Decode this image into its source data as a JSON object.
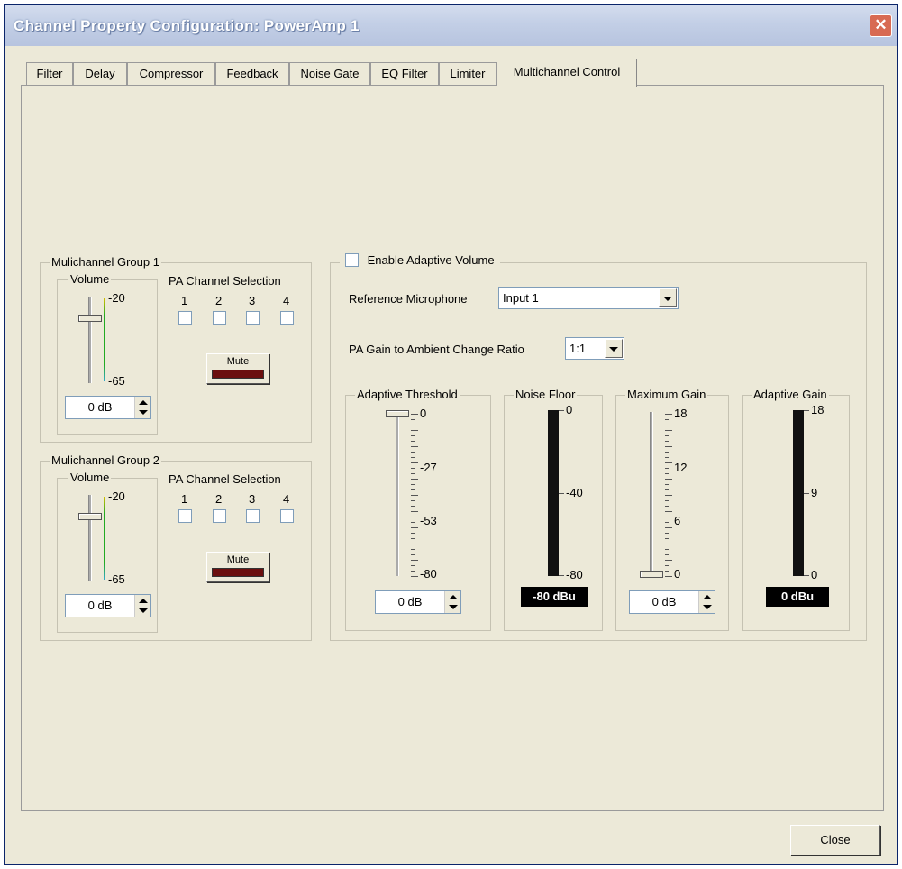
{
  "window": {
    "title": "Channel Property Configuration: PowerAmp 1",
    "close_glyph": "✕"
  },
  "tabs": [
    "Filter",
    "Delay",
    "Compressor",
    "Feedback",
    "Noise Gate",
    "EQ Filter",
    "Limiter",
    "Multichannel Control"
  ],
  "active_tab": "Multichannel Control",
  "group1": {
    "title": "Mulichannel Group 1",
    "volume_label": "Volume",
    "scale_top": "-20",
    "scale_bottom": "-65",
    "value": "0 dB",
    "pa_label": "PA Channel Selection",
    "channels": [
      "1",
      "2",
      "3",
      "4"
    ],
    "mute_label": "Mute"
  },
  "group2": {
    "title": "Mulichannel Group 2",
    "volume_label": "Volume",
    "scale_top": "-20",
    "scale_bottom": "-65",
    "value": "0 dB",
    "pa_label": "PA Channel Selection",
    "channels": [
      "1",
      "2",
      "3",
      "4"
    ],
    "mute_label": "Mute"
  },
  "adaptive": {
    "enable_label": "Enable Adaptive Volume",
    "ref_mic_label": "Reference Microphone",
    "ref_mic_value": "Input 1",
    "ratio_label": "PA Gain to Ambient Change Ratio",
    "ratio_value": "1:1",
    "threshold": {
      "title": "Adaptive Threshold",
      "ticks": [
        "0",
        "-27",
        "-53",
        "-80"
      ],
      "value": "0 dB"
    },
    "noise_floor": {
      "title": "Noise Floor",
      "ticks": [
        "0",
        "-40",
        "-80"
      ],
      "readout": "-80 dBu"
    },
    "max_gain": {
      "title": "Maximum Gain",
      "ticks": [
        "18",
        "12",
        "6",
        "0"
      ],
      "value": "0 dB"
    },
    "adaptive_gain": {
      "title": "Adaptive Gain",
      "ticks": [
        "18",
        "9",
        "0"
      ],
      "readout": "0 dBu"
    }
  },
  "footer": {
    "close_label": "Close"
  }
}
